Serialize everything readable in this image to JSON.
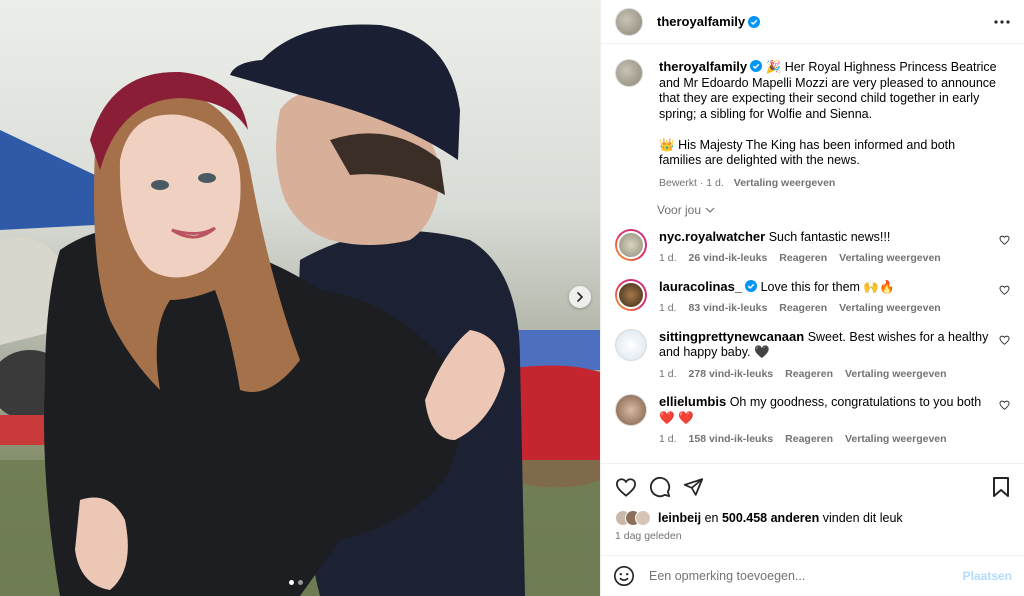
{
  "post": {
    "account": "theroyalfamily",
    "caption_line1_emoji": "🎉",
    "caption": "Her Royal Highness Princess Beatrice and Mr Edoardo Mapelli Mozzi are very pleased to announce that they are expecting their second child together in early spring; a sibling for Wolfie and Sienna.",
    "caption2_emoji": "👑",
    "caption2": "His Majesty The King has been informed and both families are delighted with the news.",
    "age": "Bewerkt · 1 d.",
    "translate": "Vertaling weergeven"
  },
  "for_you": "Voor jou",
  "comments": [
    {
      "user": "nyc.royalwatcher",
      "text": "Such fantastic news!!!",
      "time": "1 d.",
      "likes": "26 vind-ik-leuks",
      "reply": "Reageren",
      "translate": "Vertaling weergeven",
      "verified": false
    },
    {
      "user": "lauracolinas_",
      "text": "Love this for them 🙌🔥",
      "time": "1 d.",
      "likes": "83 vind-ik-leuks",
      "reply": "Reageren",
      "translate": "Vertaling weergeven",
      "verified": true
    },
    {
      "user": "sittingprettynewcanaan",
      "text": "Sweet. Best wishes for a healthy and happy baby. 🖤",
      "time": "1 d.",
      "likes": "278 vind-ik-leuks",
      "reply": "Reageren",
      "translate": "Vertaling weergeven",
      "verified": false
    },
    {
      "user": "ellielumbis",
      "text": "Oh my goodness, congratulations to you both ❤️ ❤️",
      "time": "1 d.",
      "likes": "158 vind-ik-leuks",
      "reply": "Reageren",
      "translate": "Vertaling weergeven",
      "verified": false
    }
  ],
  "likes_summary": {
    "user": "leinbeij",
    "joiner": "en",
    "count": "500.458 anderen",
    "suffix": "vinden dit leuk"
  },
  "post_date": "1 dag geleden",
  "comment_box": {
    "placeholder": "Een opmerking toevoegen...",
    "post_label": "Plaatsen"
  },
  "carousel": {
    "total": 2,
    "current": 1
  },
  "colors": {
    "verified": "#0095f6",
    "muted": "#737373",
    "post_disabled": "#b3dbff"
  }
}
